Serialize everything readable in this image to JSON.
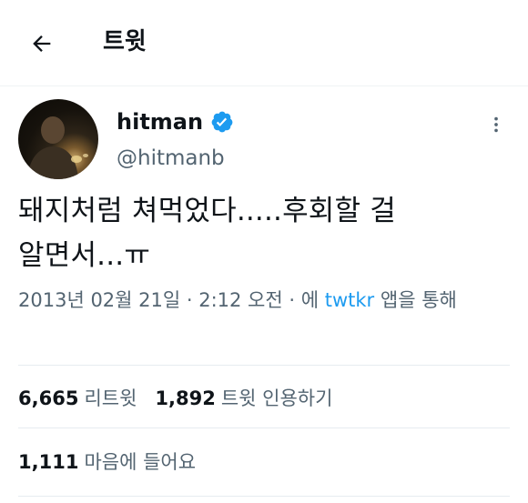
{
  "header": {
    "back_icon": "arrow-left-icon",
    "title": "트윗"
  },
  "author": {
    "display_name": "hitman",
    "handle": "@hitmanb",
    "verified_icon": "verified-badge-icon",
    "verified_color": "#1d9bf0"
  },
  "more_icon": "more-vertical-icon",
  "tweet": {
    "text": "돼지처럼 쳐먹었다.....후회할 걸 알면서...ㅠ",
    "timestamp": "2013년 02월 21일 · 2:12 오전 · 에",
    "app_name": "twtkr",
    "app_suffix": "앱을 통해"
  },
  "stats": {
    "retweets": {
      "count": "6,665",
      "label": "리트윗"
    },
    "quotes": {
      "count": "1,892",
      "label": "트윗 인용하기"
    },
    "likes": {
      "count": "1,111",
      "label": "마음에 들어요"
    }
  },
  "colors": {
    "link": "#1d9bf0",
    "secondary_text": "#536471",
    "primary_text": "#0f1419",
    "divider": "#e6ecf0"
  }
}
